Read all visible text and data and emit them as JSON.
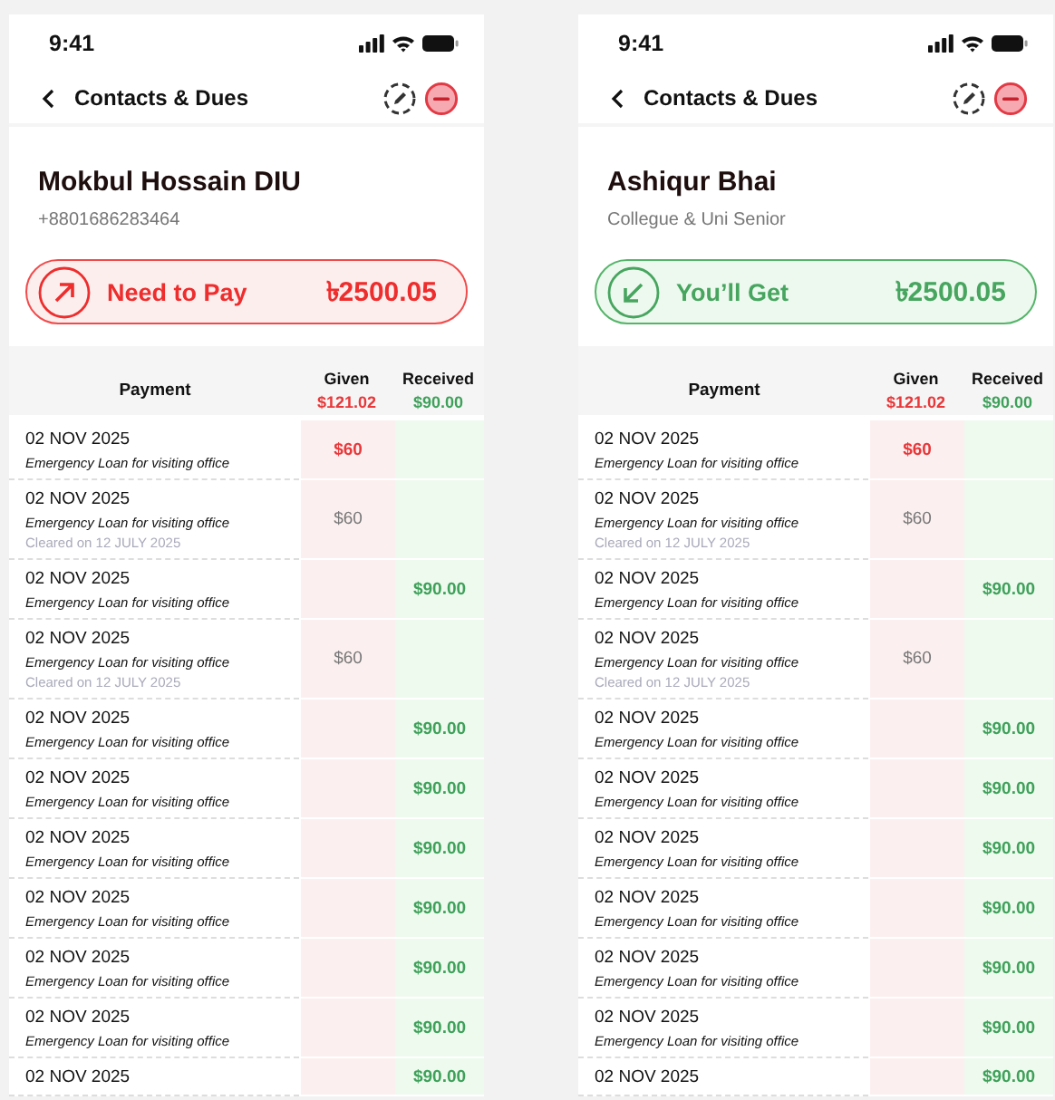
{
  "screens": [
    {
      "time": "9:41",
      "title": "Contacts & Dues",
      "contact": {
        "name": "Mokbul Hossain DIU",
        "subtitle": "+8801686283464"
      },
      "balance": {
        "kind": "pay",
        "label": "Need to Pay",
        "amount": "৳2500.05"
      },
      "table": {
        "payment_header": "Payment",
        "given_header": "Given",
        "given_total": "$121.02",
        "received_header": "Received",
        "received_total": "$90.00",
        "rows": [
          {
            "date": "02 NOV 2025",
            "note": "Emergency Loan for visiting office",
            "given": "$60",
            "settled": false
          },
          {
            "date": "02 NOV 2025",
            "note": "Emergency Loan for visiting office",
            "cleared_note": "Cleared on 12 JULY 2025",
            "given": "$60",
            "settled": true
          },
          {
            "date": "02 NOV 2025",
            "note": "Emergency Loan for visiting office",
            "received": "$90.00"
          },
          {
            "date": "02 NOV 2025",
            "note": "Emergency Loan for visiting office",
            "cleared_note": "Cleared on 12 JULY 2025",
            "given": "$60",
            "settled": true
          },
          {
            "date": "02 NOV 2025",
            "note": "Emergency Loan for visiting office",
            "received": "$90.00"
          },
          {
            "date": "02 NOV 2025",
            "note": "Emergency Loan for visiting office",
            "received": "$90.00"
          },
          {
            "date": "02 NOV 2025",
            "note": "Emergency Loan for visiting office",
            "received": "$90.00"
          },
          {
            "date": "02 NOV 2025",
            "note": "Emergency Loan for visiting office",
            "received": "$90.00"
          },
          {
            "date": "02 NOV 2025",
            "note": "Emergency Loan for visiting office",
            "received": "$90.00"
          },
          {
            "date": "02 NOV 2025",
            "note": "Emergency Loan for visiting office",
            "received": "$90.00"
          },
          {
            "date": "02 NOV 2025",
            "received": "$90.00"
          }
        ]
      }
    },
    {
      "time": "9:41",
      "title": "Contacts & Dues",
      "contact": {
        "name": "Ashiqur Bhai",
        "subtitle": "Collegue & Uni Senior"
      },
      "balance": {
        "kind": "get",
        "label": "You’ll Get",
        "amount": "৳2500.05"
      },
      "table": {
        "payment_header": "Payment",
        "given_header": "Given",
        "given_total": "$121.02",
        "received_header": "Received",
        "received_total": "$90.00",
        "rows": [
          {
            "date": "02 NOV 2025",
            "note": "Emergency Loan for visiting office",
            "given": "$60",
            "settled": false
          },
          {
            "date": "02 NOV 2025",
            "note": "Emergency Loan for visiting office",
            "cleared_note": "Cleared on 12 JULY 2025",
            "given": "$60",
            "settled": true
          },
          {
            "date": "02 NOV 2025",
            "note": "Emergency Loan for visiting office",
            "received": "$90.00"
          },
          {
            "date": "02 NOV 2025",
            "note": "Emergency Loan for visiting office",
            "cleared_note": "Cleared on 12 JULY 2025",
            "given": "$60",
            "settled": true
          },
          {
            "date": "02 NOV 2025",
            "note": "Emergency Loan for visiting office",
            "received": "$90.00"
          },
          {
            "date": "02 NOV 2025",
            "note": "Emergency Loan for visiting office",
            "received": "$90.00"
          },
          {
            "date": "02 NOV 2025",
            "note": "Emergency Loan for visiting office",
            "received": "$90.00"
          },
          {
            "date": "02 NOV 2025",
            "note": "Emergency Loan for visiting office",
            "received": "$90.00"
          },
          {
            "date": "02 NOV 2025",
            "note": "Emergency Loan for visiting office",
            "received": "$90.00"
          },
          {
            "date": "02 NOV 2025",
            "note": "Emergency Loan for visiting office",
            "received": "$90.00"
          },
          {
            "date": "02 NOV 2025",
            "received": "$90.00"
          }
        ]
      }
    }
  ]
}
